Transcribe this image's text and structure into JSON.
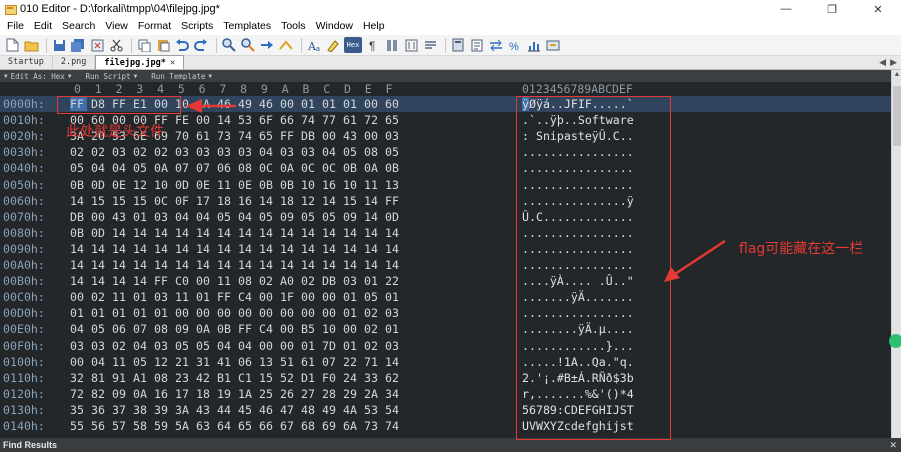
{
  "window": {
    "title": "010 Editor - D:\\forkali\\tmpp\\04\\filejpg.jpg*",
    "minimize": "—",
    "restore": "❐",
    "close": "✕"
  },
  "menu": [
    "File",
    "Edit",
    "Search",
    "View",
    "Format",
    "Scripts",
    "Templates",
    "Tools",
    "Window",
    "Help"
  ],
  "toolbar": {
    "icons": [
      "new-file-icon",
      "open-folder-icon",
      "save-icon",
      "save-all-icon",
      "close-file-icon",
      "cut-icon",
      "copy-icon",
      "paste-icon",
      "undo-icon",
      "redo-icon",
      "find-icon",
      "find-next-icon",
      "replace-icon",
      "goto-icon",
      "font-icon",
      "highlight-icon",
      "hex-view-icon",
      "paragraph-icon",
      "columns-icon",
      "insert-icon",
      "calculator-icon",
      "compare-icon",
      "percent-icon",
      "histogram-icon",
      "bookmark-icon"
    ],
    "hex_label": "Hex"
  },
  "tabs": [
    {
      "label": "Startup",
      "active": false
    },
    {
      "label": "2.png",
      "active": false
    },
    {
      "label": "filejpg.jpg*",
      "active": true
    }
  ],
  "editbar": {
    "edit_as": "Edit As: Hex",
    "run_script": "Run Script",
    "run_template": "Run Template"
  },
  "hex": {
    "column_header": "0  1  2  3  4  5  6  7  8  9  A  B  C  D  E  F",
    "ascii_header": "0123456789ABCDEF",
    "rows": [
      {
        "addr": "0000h:",
        "bytes": "FF D8 FF E1 00 10 4A 46 49 46 00 01 01 01 00 60",
        "ascii": "ÿØÿá..JFIF.....`"
      },
      {
        "addr": "0010h:",
        "bytes": "00 60 00 00 FF FE 00 14 53 6F 66 74 77 61 72 65",
        "ascii": ".`..ÿþ..Software"
      },
      {
        "addr": "0020h:",
        "bytes": "3A 20 53 6E 69 70 61 73 74 65 FF DB 00 43 00 03",
        "ascii": ": SnipasteÿÛ.C.."
      },
      {
        "addr": "0030h:",
        "bytes": "02 02 03 02 02 03 03 03 03 04 03 03 04 05 08 05",
        "ascii": "................"
      },
      {
        "addr": "0040h:",
        "bytes": "05 04 04 05 0A 07 07 06 08 0C 0A 0C 0C 0B 0A 0B",
        "ascii": "................"
      },
      {
        "addr": "0050h:",
        "bytes": "0B 0D 0E 12 10 0D 0E 11 0E 0B 0B 10 16 10 11 13",
        "ascii": "................"
      },
      {
        "addr": "0060h:",
        "bytes": "14 15 15 15 0C 0F 17 18 16 14 18 12 14 15 14 FF",
        "ascii": "...............ÿ"
      },
      {
        "addr": "0070h:",
        "bytes": "DB 00 43 01 03 04 04 05 04 05 09 05 05 09 14 0D",
        "ascii": "Û.C............."
      },
      {
        "addr": "0080h:",
        "bytes": "0B 0D 14 14 14 14 14 14 14 14 14 14 14 14 14 14",
        "ascii": "................"
      },
      {
        "addr": "0090h:",
        "bytes": "14 14 14 14 14 14 14 14 14 14 14 14 14 14 14 14",
        "ascii": "................"
      },
      {
        "addr": "00A0h:",
        "bytes": "14 14 14 14 14 14 14 14 14 14 14 14 14 14 14 14",
        "ascii": "................"
      },
      {
        "addr": "00B0h:",
        "bytes": "14 14 14 14 FF C0 00 11 08 02 A0 02 DB 03 01 22",
        "ascii": "....ÿÀ.... .Û..\""
      },
      {
        "addr": "00C0h:",
        "bytes": "00 02 11 01 03 11 01 FF C4 00 1F 00 00 01 05 01",
        "ascii": ".......ÿÄ......."
      },
      {
        "addr": "00D0h:",
        "bytes": "01 01 01 01 01 00 00 00 00 00 00 00 00 01 02 03",
        "ascii": "................"
      },
      {
        "addr": "00E0h:",
        "bytes": "04 05 06 07 08 09 0A 0B FF C4 00 B5 10 00 02 01",
        "ascii": "........ÿÄ.µ...."
      },
      {
        "addr": "00F0h:",
        "bytes": "03 03 02 04 03 05 05 04 04 00 00 01 7D 01 02 03",
        "ascii": "............}..."
      },
      {
        "addr": "0100h:",
        "bytes": "00 04 11 05 12 21 31 41 06 13 51 61 07 22 71 14",
        "ascii": ".....!1A..Qa.\"q."
      },
      {
        "addr": "0110h:",
        "bytes": "32 81 91 A1 08 23 42 B1 C1 15 52 D1 F0 24 33 62",
        "ascii": "2.'¡.#B±Á.RÑð$3b"
      },
      {
        "addr": "0120h:",
        "bytes": "72 82 09 0A 16 17 18 19 1A 25 26 27 28 29 2A 34",
        "ascii": "r,.......%&'()*4"
      },
      {
        "addr": "0130h:",
        "bytes": "35 36 37 38 39 3A 43 44 45 46 47 48 49 4A 53 54",
        "ascii": "56789:CDEFGHIJST"
      },
      {
        "addr": "0140h:",
        "bytes": "55 56 57 58 59 5A 63 64 65 66 67 68 69 6A 73 74",
        "ascii": "UVWXYZcdefghijst"
      }
    ]
  },
  "annotations": {
    "header_note": "此处就是头文件",
    "flag_note": "flag可能藏在这一栏"
  },
  "find_results": "Find Results",
  "colors": {
    "hex_background": "#23272a",
    "annotation_red": "#e53935",
    "selected_row": "#31445e"
  }
}
